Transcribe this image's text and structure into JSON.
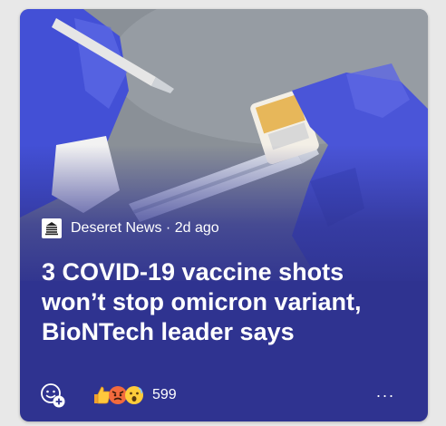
{
  "card": {
    "source": {
      "logo_icon": "deseret-news-logo",
      "text": "Deseret News · 2d ago"
    },
    "headline": "3 COVID-19 vaccine shots won’t stop omicron variant, BioNTech leader says",
    "footer": {
      "add_reaction_icon": "add-reaction-icon",
      "reaction_icons": [
        "thumbs-up-emoji",
        "angry-emoji",
        "surprised-emoji"
      ],
      "reaction_count": "599",
      "more_label": "···"
    }
  },
  "colors": {
    "card_background": "#2f3390",
    "glove": "#4a55d8",
    "text": "#ffffff"
  }
}
